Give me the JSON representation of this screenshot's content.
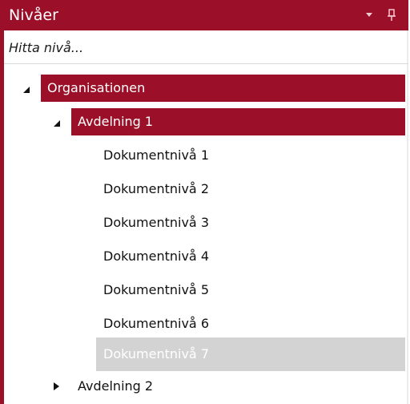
{
  "panel": {
    "title": "Nivåer",
    "dropdown_icon": "dropdown-arrow-icon",
    "pin_icon": "pin-icon"
  },
  "search": {
    "placeholder": "Hitta nivå..."
  },
  "tree": {
    "root": {
      "label": "Organisationen",
      "expanded": true,
      "selected": true
    },
    "avdelning1": {
      "label": "Avdelning 1",
      "expanded": true,
      "selected": true
    },
    "documents": [
      {
        "label": "Dokumentnivå 1"
      },
      {
        "label": "Dokumentnivå 2"
      },
      {
        "label": "Dokumentnivå 3"
      },
      {
        "label": "Dokumentnivå 4"
      },
      {
        "label": "Dokumentnivå 5"
      },
      {
        "label": "Dokumentnivå 6"
      },
      {
        "label": "Dokumentnivå 7",
        "state": "disabled-selected"
      }
    ],
    "avdelning2": {
      "label": "Avdelning 2",
      "expanded": false
    }
  },
  "colors": {
    "accent": "#9b0f28",
    "disabled_selection": "#d3d3d3",
    "text": "#111111"
  }
}
